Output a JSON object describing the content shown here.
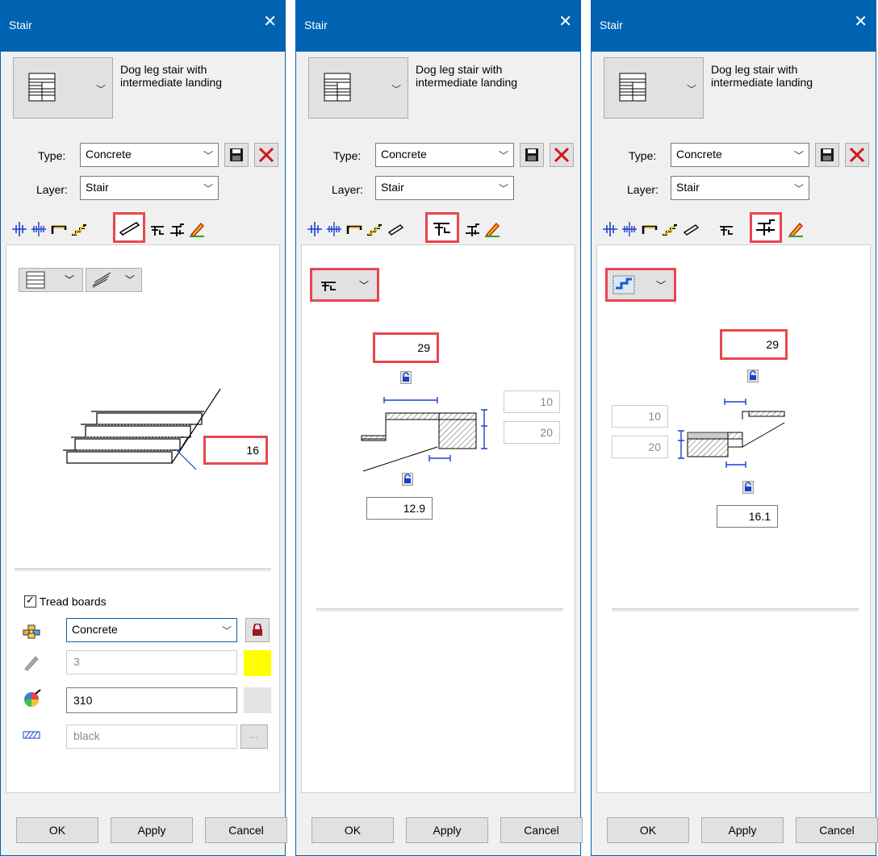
{
  "dialogs": [
    {
      "title": "Stair",
      "description": [
        "Dog leg stair with",
        "intermediate landing"
      ],
      "type_label": "Type:",
      "type_value": "Concrete",
      "layer_label": "Layer:",
      "layer_value": "Stair",
      "active_tab": 4,
      "main_value": "16",
      "tread_boards_label": "Tread boards",
      "tread_boards_checked": true,
      "material_value": "Concrete",
      "pen_value": "3",
      "color_value": "310",
      "line_value": "black",
      "ok": "OK",
      "apply": "Apply",
      "cancel": "Cancel"
    },
    {
      "title": "Stair",
      "description": [
        "Dog leg stair with",
        "intermediate landing"
      ],
      "type_label": "Type:",
      "type_value": "Concrete",
      "layer_label": "Layer:",
      "layer_value": "Stair",
      "active_tab": 5,
      "top_value": "29",
      "right_top_value": "10",
      "right_bottom_value": "20",
      "bottom_value": "12.9",
      "ok": "OK",
      "apply": "Apply",
      "cancel": "Cancel"
    },
    {
      "title": "Stair",
      "description": [
        "Dog leg stair with",
        "intermediate landing"
      ],
      "type_label": "Type:",
      "type_value": "Concrete",
      "layer_label": "Layer:",
      "layer_value": "Stair",
      "active_tab": 6,
      "top_value": "29",
      "left_top_value": "10",
      "left_bottom_value": "20",
      "bottom_value": "16.1",
      "ok": "OK",
      "apply": "Apply",
      "cancel": "Cancel"
    }
  ],
  "colors": {
    "titlebar": "#0063b1",
    "highlight": "#e8474f",
    "yellow": "#ffff00",
    "lock_red": "#a0141e"
  },
  "tab_icons": [
    "axis-cross-icon",
    "axis-split-icon",
    "stair-profile-icon",
    "steps-icon",
    "tread-board-icon",
    "landing-icon",
    "stair-section-icon",
    "paint-icon"
  ]
}
